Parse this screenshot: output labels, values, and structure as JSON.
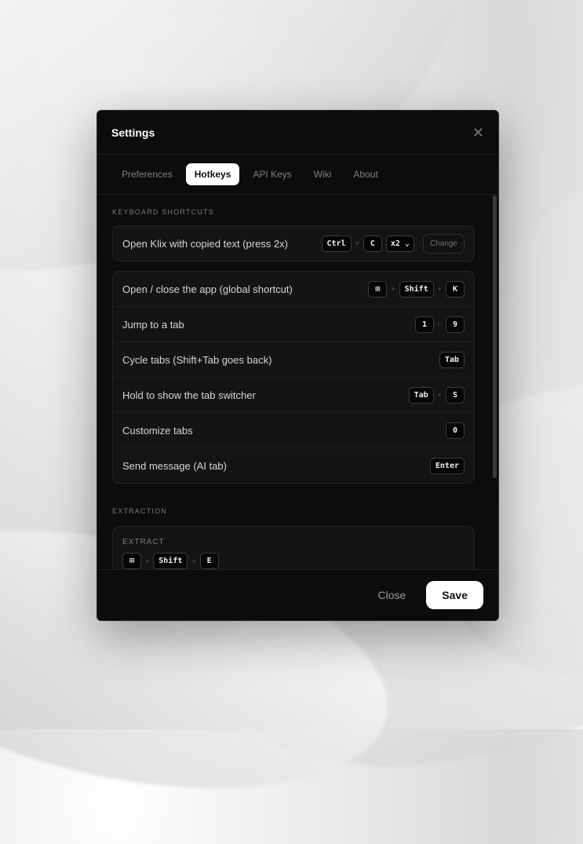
{
  "dialog": {
    "title": "Settings",
    "close_icon": "close-icon"
  },
  "tabs": [
    {
      "label": "Preferences",
      "active": false
    },
    {
      "label": "Hotkeys",
      "active": true
    },
    {
      "label": "API Keys",
      "active": false
    },
    {
      "label": "Wiki",
      "active": false
    },
    {
      "label": "About",
      "active": false
    }
  ],
  "shortcuts": {
    "section_label": "KEYBOARD SHORTCUTS",
    "primary": {
      "label": "Open Klix with copied text (press 2x)",
      "keys": [
        "Ctrl",
        "C"
      ],
      "repeat_select": "x2",
      "change_label": "Change"
    },
    "rows": [
      {
        "label": "Open / close the app (global shortcut)",
        "keys": [
          "⊞",
          "Shift",
          "K"
        ]
      },
      {
        "label": "Jump to a tab",
        "keys": [
          "1",
          "9"
        ]
      },
      {
        "label": "Cycle tabs (Shift+Tab goes back)",
        "keys": [
          "Tab"
        ]
      },
      {
        "label": "Hold to show the tab switcher",
        "keys": [
          "Tab",
          "S"
        ]
      },
      {
        "label": "Customize tabs",
        "keys": [
          "0"
        ]
      },
      {
        "label": "Send message (AI tab)",
        "keys": [
          "Enter"
        ]
      }
    ]
  },
  "extraction": {
    "section_label": "EXTRACTION",
    "card_label": "EXTRACT",
    "keys": [
      "⊞",
      "Shift",
      "E"
    ]
  },
  "footer": {
    "close_label": "Close",
    "save_label": "Save"
  },
  "colors": {
    "dialog_bg": "#0c0c0c",
    "accent": "#ffffff"
  }
}
